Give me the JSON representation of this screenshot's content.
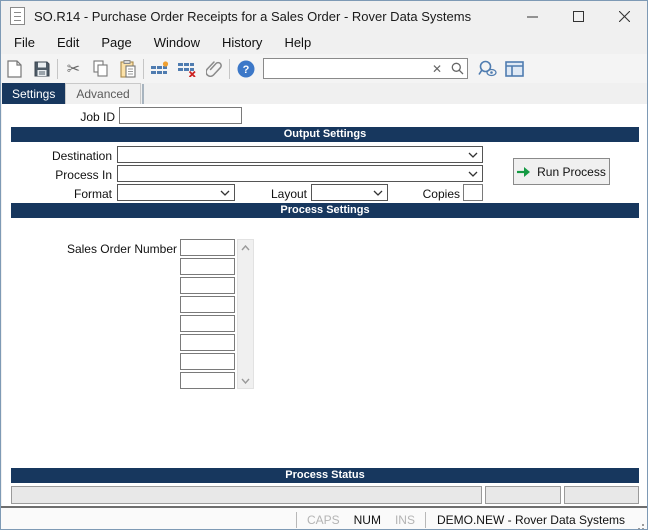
{
  "window": {
    "title": "SO.R14 - Purchase Order Receipts for a Sales Order - Rover Data Systems"
  },
  "menu": {
    "items": [
      "File",
      "Edit",
      "Page",
      "Window",
      "History",
      "Help"
    ]
  },
  "toolbar": {
    "icons": [
      "new-document",
      "save",
      "cut",
      "copy",
      "paste",
      "insert-rows",
      "delete-rows",
      "attachment",
      "help",
      "clear-search",
      "search",
      "lookup-preview",
      "browse-table"
    ],
    "search": {
      "value": "",
      "placeholder": ""
    }
  },
  "tabs": [
    {
      "label": "Settings",
      "active": true
    },
    {
      "label": "Advanced",
      "active": false
    }
  ],
  "form": {
    "job_id_label": "Job ID",
    "job_id_value": "",
    "sections": {
      "output": "Output Settings",
      "process": "Process Settings",
      "status": "Process Status"
    },
    "output": {
      "destination_label": "Destination",
      "destination_value": "",
      "process_in_label": "Process In",
      "process_in_value": "",
      "format_label": "Format",
      "format_value": "",
      "layout_label": "Layout",
      "layout_value": "",
      "copies_label": "Copies",
      "copies_value": "",
      "run_button_label": "Run Process"
    },
    "process": {
      "sales_order_label": "Sales Order Number",
      "sales_order_values": [
        "",
        "",
        "",
        "",
        "",
        "",
        "",
        ""
      ]
    }
  },
  "statusbar": {
    "caps": "CAPS",
    "num": "NUM",
    "ins": "INS",
    "caps_active": false,
    "num_active": true,
    "ins_active": false,
    "context": "DEMO.NEW - Rover Data Systems"
  },
  "colors": {
    "section_navy": "#17375e",
    "help_blue": "#3c78c8",
    "icon_blue": "#4f7cb0",
    "run_green": "#149a43",
    "insert_orange": "#f0a030",
    "delete_red": "#cc2222"
  }
}
